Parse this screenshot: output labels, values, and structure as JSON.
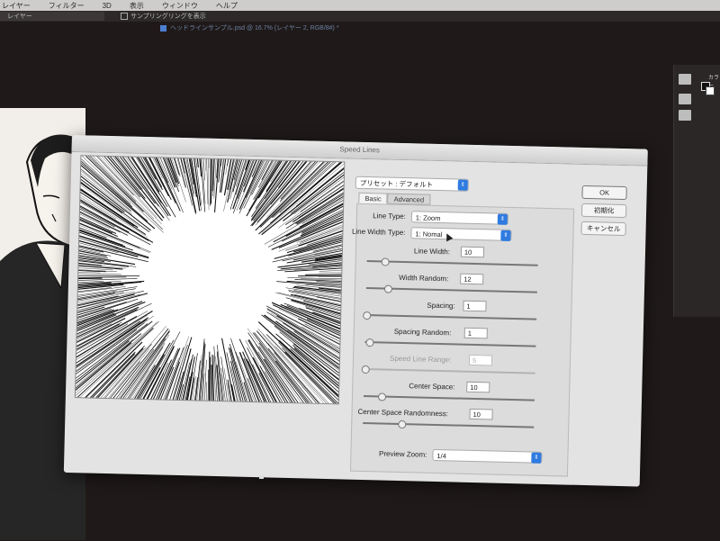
{
  "menubar": {
    "items": [
      "レイヤー",
      "フィルター",
      "3D",
      "表示",
      "ウィンドウ",
      "ヘルプ"
    ]
  },
  "options_bar": {
    "layer_select": "レイヤー",
    "sampling_ring_label": "サンプリングリングを表示"
  },
  "document_tab": {
    "title": "ヘッドラインサンプル.psd @ 16.7% (レイヤー 2, RGB/8#) *"
  },
  "right_panel": {
    "label": "カラー"
  },
  "dialog": {
    "title": "Speed Lines",
    "preset": "プリセット : デフォルト",
    "tabs": [
      "Basic",
      "Advanced"
    ],
    "active_tab": "Basic",
    "buttons": {
      "ok": "OK",
      "reset": "初期化",
      "cancel": "キャンセル"
    },
    "line_type": {
      "label": "Line Type:",
      "value": "1: Zoom"
    },
    "line_width_type": {
      "label": "Line Width Type:",
      "value": "1: Nomal"
    },
    "sliders": [
      {
        "label": "Line Width:",
        "value": "10",
        "level": 0.1
      },
      {
        "label": "Width Random:",
        "value": "12",
        "level": 0.12
      },
      {
        "label": "Spacing:",
        "value": "1",
        "level": 0.0
      },
      {
        "label": "Spacing Random:",
        "value": "1",
        "level": 0.02
      },
      {
        "label": "Speed Line Range:",
        "value": "5",
        "level": 0.0,
        "disabled": true
      },
      {
        "label": "Center Space:",
        "value": "10",
        "level": 0.1
      },
      {
        "label": "Center Space Randomness:",
        "value": "10",
        "level": 0.22
      }
    ],
    "preview_zoom": {
      "label": "Preview Zoom:",
      "value": "1/4"
    }
  },
  "colors": {
    "accent": "#2f7be0",
    "dialog_bg": "#e3e3e3",
    "app_bg": "#1f1a19"
  }
}
